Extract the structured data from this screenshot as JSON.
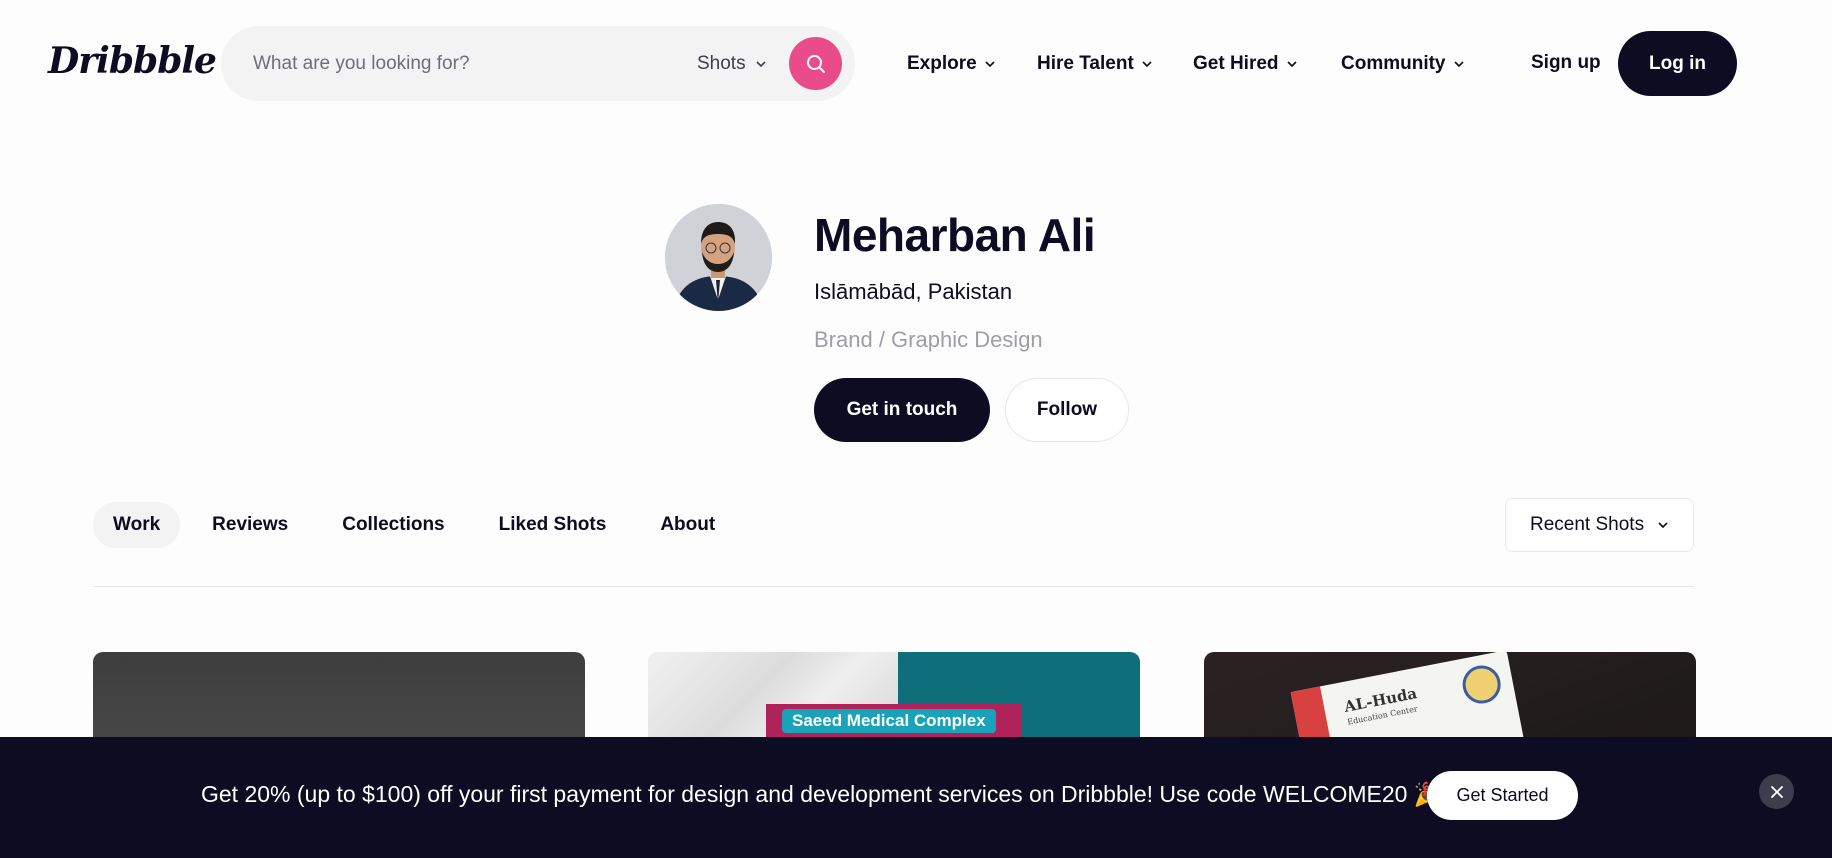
{
  "header": {
    "logo": "Dribbble",
    "search": {
      "placeholder": "What are you looking for?",
      "scope": "Shots",
      "icon": "search-icon"
    },
    "nav": [
      {
        "label": "Explore"
      },
      {
        "label": "Hire Talent"
      },
      {
        "label": "Get Hired"
      },
      {
        "label": "Community"
      }
    ],
    "signup": "Sign up",
    "login": "Log in"
  },
  "profile": {
    "name": "Meharban Ali",
    "location": "Islāmābād, Pakistan",
    "specialty": "Brand / Graphic Design",
    "contact_button": "Get in touch",
    "follow_button": "Follow"
  },
  "tabs": [
    {
      "label": "Work",
      "active": true
    },
    {
      "label": "Reviews"
    },
    {
      "label": "Collections"
    },
    {
      "label": "Liked Shots"
    },
    {
      "label": "About"
    }
  ],
  "sort": {
    "selected": "Recent Shots"
  },
  "shots": [
    {
      "text": ""
    },
    {
      "text": "Saeed Medical Complex"
    },
    {
      "title": "AL-Huda",
      "subtitle": "Education Center"
    }
  ],
  "promo": {
    "text": "Get 20% (up to $100) off your first payment for design and development services on Dribbble! Use code WELCOME20 🎉",
    "button": "Get Started"
  },
  "colors": {
    "brand_pink": "#ea4c89",
    "dark": "#0d0c22"
  }
}
